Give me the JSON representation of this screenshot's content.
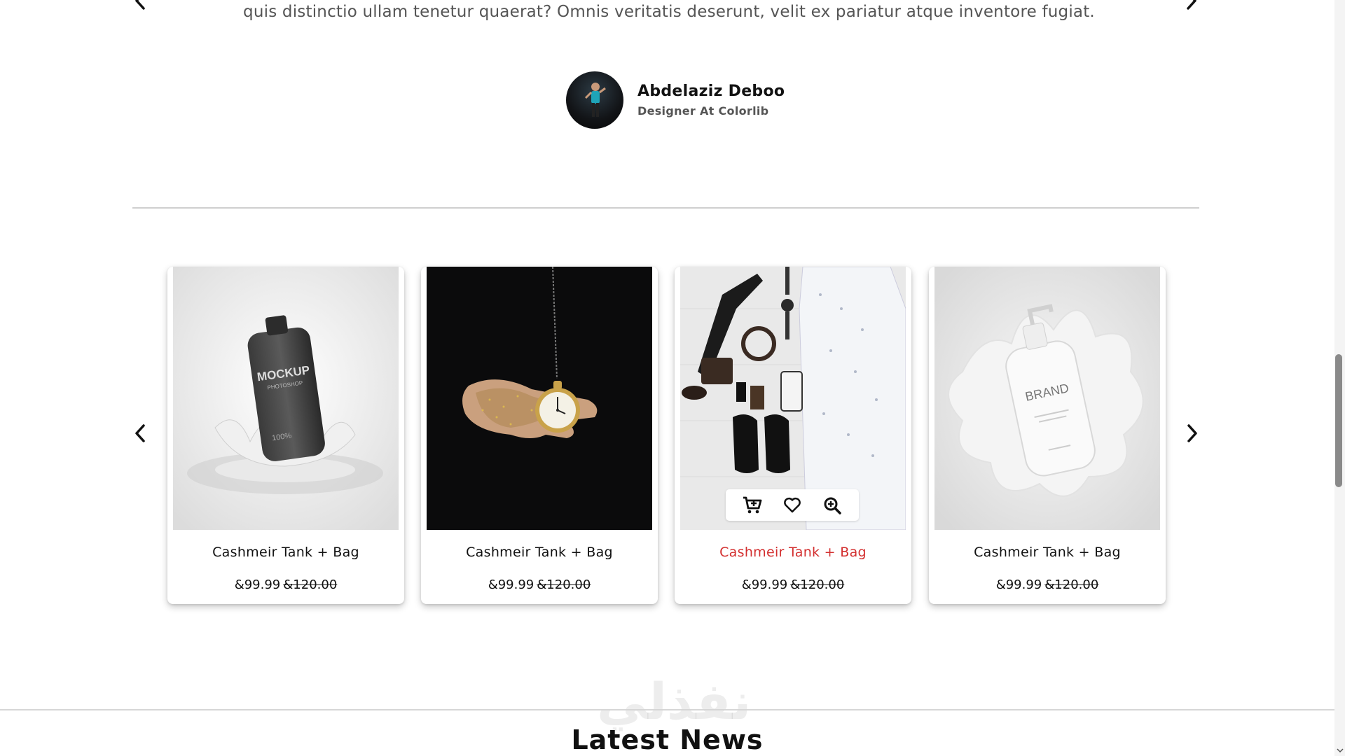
{
  "testimonial": {
    "quote": "quis distinctio ullam tenetur quaerat? Omnis veritatis deserunt, velit ex pariatur atque inventore fugiat.",
    "author_name": "Abdelaziz Deboo",
    "author_role": "Designer At Colorlib"
  },
  "products": [
    {
      "title": "Cashmeir Tank + Bag",
      "price": "&99.99",
      "old_price": "&120.00",
      "image": "dark-bottle-mockup",
      "active": false
    },
    {
      "title": "Cashmeir Tank + Bag",
      "price": "&99.99",
      "old_price": "&120.00",
      "image": "pocket-watch-hand",
      "active": false
    },
    {
      "title": "Cashmeir Tank + Bag",
      "price": "&99.99",
      "old_price": "&120.00",
      "image": "mens-flatlay",
      "active": true
    },
    {
      "title": "Cashmeir Tank + Bag",
      "price": "&99.99",
      "old_price": "&120.00",
      "image": "white-bottle-mockup",
      "active": false
    }
  ],
  "hover_actions": [
    "add-to-cart-icon",
    "heart-icon",
    "zoom-in-icon"
  ],
  "mockup_text": {
    "bottle_dark": "MOCKUP",
    "bottle_dark_sub": "PHOTOSHOP",
    "bottle_dark_pct": "100%",
    "bottle_white": "BRAND"
  },
  "latest_news_title": "Latest News",
  "watermark": "نفذلي",
  "colors": {
    "accent": "#d32f2f",
    "text": "#111111",
    "muted": "#555555",
    "divider": "#cfcfcf"
  }
}
